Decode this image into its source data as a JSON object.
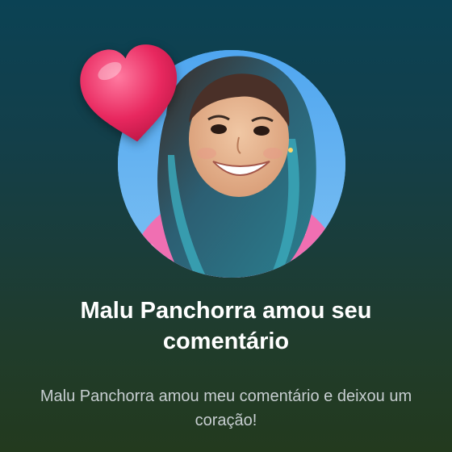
{
  "notification": {
    "title": "Malu Panchorra amou seu comentário",
    "message": "Malu Panchorra amou meu comentário e deixou um coração!"
  },
  "avatar": {
    "icon": "profile-photo"
  },
  "reaction": {
    "icon": "heart-icon",
    "color": "#e8285f"
  },
  "colors": {
    "background_top": "#0b4254",
    "background_bottom": "#233a1e",
    "title_text": "#ffffff",
    "subtitle_text": "#c7ced1"
  }
}
